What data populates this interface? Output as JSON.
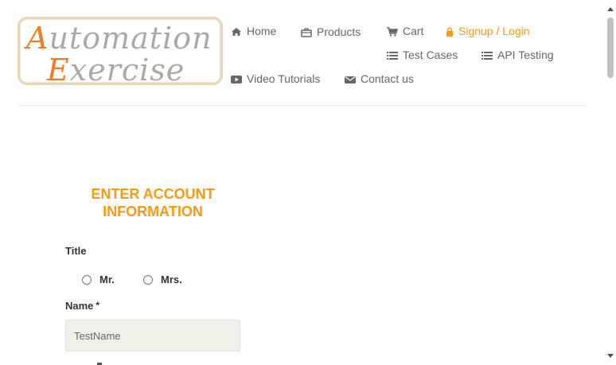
{
  "logo": {
    "line1_cap": "A",
    "line1_rest": "utomation",
    "line2_cap": "E",
    "line2_rest": "xercise"
  },
  "nav": {
    "home": "Home",
    "products": "Products",
    "cart": "Cart",
    "signup_login": "Signup / Login",
    "test_cases": "Test Cases",
    "api_testing": "API Testing",
    "video_tutorials": "Video Tutorials",
    "contact_us": "Contact us"
  },
  "form": {
    "section_title_line1": "ENTER ACCOUNT",
    "section_title_line2": "INFORMATION",
    "title_label": "Title",
    "title_options": [
      "Mr.",
      "Mrs."
    ],
    "name_label": "Name",
    "name_required_mark": "*",
    "name_value": "TestName"
  },
  "colors": {
    "accent": "#fe980f",
    "logo_orange": "#f47b20",
    "nav_text": "#696763",
    "input_bg": "#f0f0e9"
  },
  "icons": {
    "home": "home-icon",
    "products": "briefcase-icon",
    "cart": "shopping-cart-icon",
    "signup_login": "lock-icon",
    "test_cases": "list-icon",
    "api_testing": "list-icon",
    "video_tutorials": "youtube-play-icon",
    "contact_us": "envelope-icon"
  }
}
